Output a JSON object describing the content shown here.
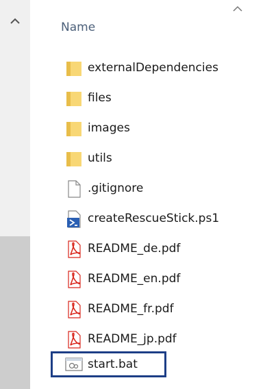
{
  "header": {
    "name_label": "Name"
  },
  "files": [
    {
      "name": "externalDependencies",
      "icon": "folder-icon"
    },
    {
      "name": "files",
      "icon": "folder-icon"
    },
    {
      "name": "images",
      "icon": "folder-icon"
    },
    {
      "name": "utils",
      "icon": "folder-icon"
    },
    {
      "name": ".gitignore",
      "icon": "blank-file-icon"
    },
    {
      "name": "createRescueStick.ps1",
      "icon": "powershell-script-icon"
    },
    {
      "name": "README_de.pdf",
      "icon": "pdf-icon"
    },
    {
      "name": "README_en.pdf",
      "icon": "pdf-icon"
    },
    {
      "name": "README_fr.pdf",
      "icon": "pdf-icon"
    },
    {
      "name": "README_jp.pdf",
      "icon": "pdf-icon"
    },
    {
      "name": "start.bat",
      "icon": "batch-file-icon",
      "highlighted": true
    }
  ],
  "colors": {
    "folder": "#f8d775",
    "pdf": "#d9261c",
    "highlight_border": "#1d3e86",
    "header_text": "#4c607a"
  }
}
